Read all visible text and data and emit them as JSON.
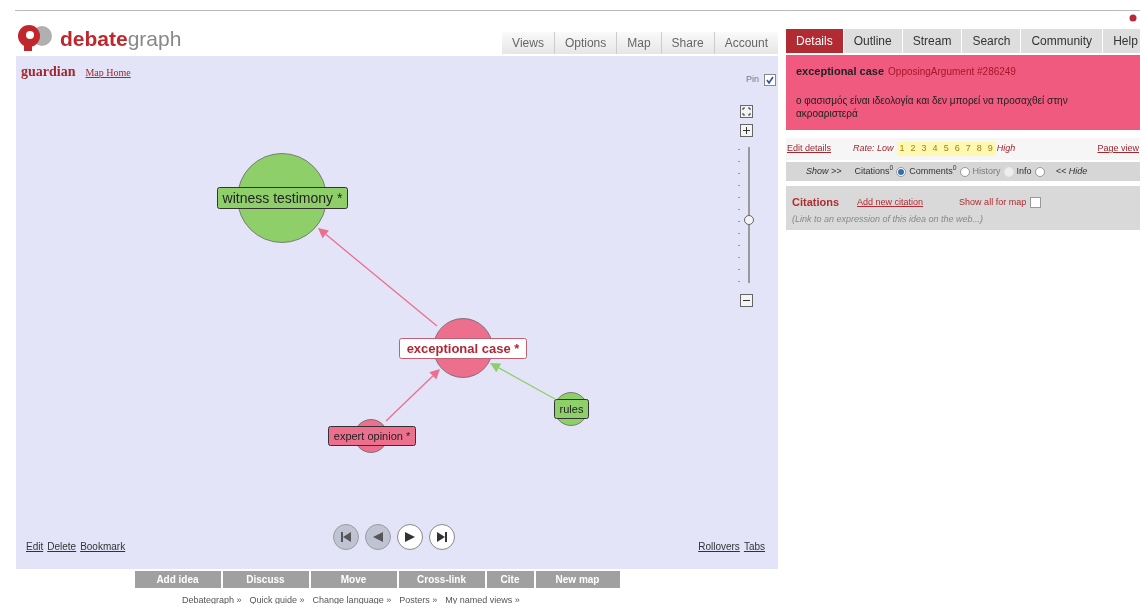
{
  "logo": {
    "bold": "debate",
    "light": "graph"
  },
  "nav": [
    "Views",
    "Options",
    "Map",
    "Share",
    "Account"
  ],
  "map": {
    "title": "guardian",
    "home_link": "Map Home",
    "pin": {
      "label": "Pin",
      "checked": true
    },
    "zoom": {
      "level": 0.46
    },
    "nodes": [
      {
        "label": "witness testimony *",
        "color": "#8fcf6a",
        "selected": false
      },
      {
        "label": "exceptional case *",
        "color": "#ec6f8e",
        "selected": true
      },
      {
        "label": "expert opinion *",
        "color": "#ec6f8e",
        "selected": false
      },
      {
        "label": "rules",
        "color": "#8fcf6a",
        "selected": false
      }
    ],
    "left_links": [
      "Edit",
      "Delete",
      "Bookmark"
    ],
    "right_links": [
      "Rollovers",
      "Tabs"
    ],
    "playback": [
      {
        "kind": "first",
        "disabled": true
      },
      {
        "kind": "back",
        "disabled": true
      },
      {
        "kind": "play",
        "disabled": false
      },
      {
        "kind": "last",
        "disabled": false
      }
    ]
  },
  "toolbar": [
    "Add idea",
    "Discuss",
    "Move",
    "Cross-link",
    "Cite",
    "New map"
  ],
  "footer_links": [
    "Debategraph »",
    "Quick guide »",
    "Change language »",
    "Posters »",
    "My named views »"
  ],
  "panel": {
    "tabs": [
      {
        "label": "Details",
        "selected": true
      },
      {
        "label": "Outline",
        "selected": false
      },
      {
        "label": "Stream",
        "selected": false
      },
      {
        "label": "Search",
        "selected": false
      },
      {
        "label": "Community",
        "selected": false
      },
      {
        "label": "Help",
        "selected": false
      }
    ],
    "title": "exceptional case",
    "type": "OpposingArgument #286249",
    "description": "ο φασισμός είναι ιδεολογία και δεν μπορεί να προσαχθεί στην ακροαριστερά",
    "edit_link": "Edit details",
    "rate_label": "Rate: Low",
    "rate_values": [
      "1",
      "2",
      "3",
      "4",
      "5",
      "6",
      "7",
      "8",
      "9"
    ],
    "rate_high": "High",
    "page_view": "Page view",
    "show_label": "Show >>",
    "hide_label": "<< Hide",
    "sections": [
      {
        "label": "Citations",
        "count": "0",
        "selected": true,
        "disabled": false
      },
      {
        "label": "Comments",
        "count": "0",
        "selected": false,
        "disabled": false
      },
      {
        "label": "History",
        "selected": false,
        "disabled": true
      },
      {
        "label": "Info",
        "selected": false,
        "disabled": false
      }
    ],
    "citations": {
      "title": "Citations",
      "add_link": "Add new citation",
      "show_all": {
        "label": "Show all for map",
        "checked": false
      },
      "hint": "(Link to an expression of this idea on the web...)"
    }
  }
}
